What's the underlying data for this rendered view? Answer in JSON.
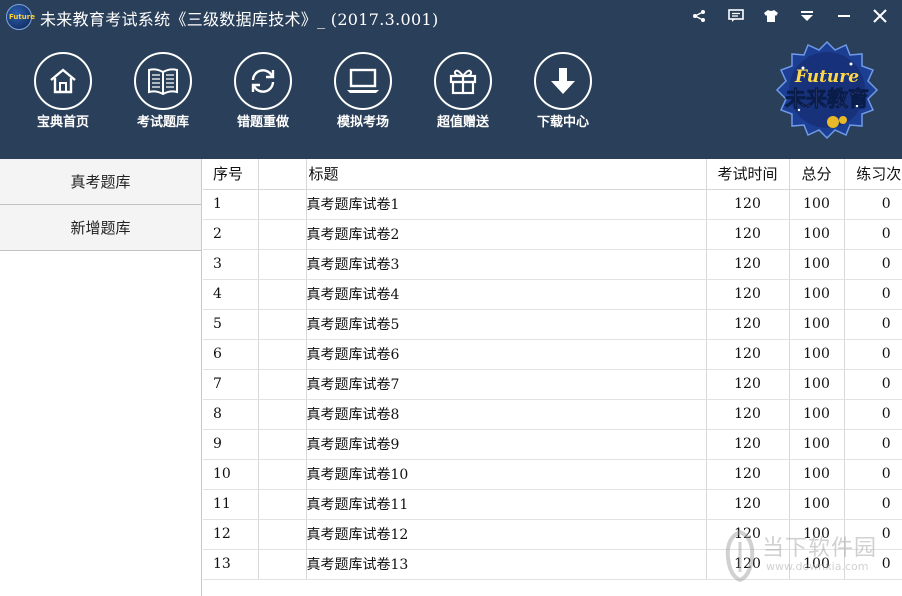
{
  "app": {
    "title": "未来教育考试系统《三级数据库技术》_ (2017.3.001)",
    "logo_text": "Future",
    "brand_text_en": "Future",
    "brand_text_cn": "未来教育"
  },
  "window_controls": [
    "share-icon",
    "message-icon",
    "skin-icon",
    "menu-icon",
    "minimize-icon",
    "close-icon"
  ],
  "toolbar": [
    {
      "label": "宝典首页",
      "icon": "home-icon"
    },
    {
      "label": "考试题库",
      "icon": "book-icon"
    },
    {
      "label": "错题重做",
      "icon": "refresh-icon"
    },
    {
      "label": "模拟考场",
      "icon": "laptop-icon"
    },
    {
      "label": "超值赠送",
      "icon": "gift-icon"
    },
    {
      "label": "下载中心",
      "icon": "download-icon"
    }
  ],
  "sidebar": {
    "items": [
      {
        "label": "真考题库"
      },
      {
        "label": "新增题库"
      }
    ]
  },
  "table": {
    "headers": {
      "no": "序号",
      "title": "标题",
      "time": "考试时间",
      "score": "总分",
      "count": "练习次数"
    },
    "rows": [
      {
        "no": "1",
        "title": "真考题库试卷1",
        "time": "120",
        "score": "100",
        "count": "0"
      },
      {
        "no": "2",
        "title": "真考题库试卷2",
        "time": "120",
        "score": "100",
        "count": "0"
      },
      {
        "no": "3",
        "title": "真考题库试卷3",
        "time": "120",
        "score": "100",
        "count": "0"
      },
      {
        "no": "4",
        "title": "真考题库试卷4",
        "time": "120",
        "score": "100",
        "count": "0"
      },
      {
        "no": "5",
        "title": "真考题库试卷5",
        "time": "120",
        "score": "100",
        "count": "0"
      },
      {
        "no": "6",
        "title": "真考题库试卷6",
        "time": "120",
        "score": "100",
        "count": "0"
      },
      {
        "no": "7",
        "title": "真考题库试卷7",
        "time": "120",
        "score": "100",
        "count": "0"
      },
      {
        "no": "8",
        "title": "真考题库试卷8",
        "time": "120",
        "score": "100",
        "count": "0"
      },
      {
        "no": "9",
        "title": "真考题库试卷9",
        "time": "120",
        "score": "100",
        "count": "0"
      },
      {
        "no": "10",
        "title": "真考题库试卷10",
        "time": "120",
        "score": "100",
        "count": "0"
      },
      {
        "no": "11",
        "title": "真考题库试卷11",
        "time": "120",
        "score": "100",
        "count": "0"
      },
      {
        "no": "12",
        "title": "真考题库试卷12",
        "time": "120",
        "score": "100",
        "count": "0"
      },
      {
        "no": "13",
        "title": "真考题库试卷13",
        "time": "120",
        "score": "100",
        "count": "0"
      }
    ]
  },
  "watermark": {
    "line1": "当下软件园",
    "line2": "www.downxia.com"
  },
  "colors": {
    "header_bg": "#2a3f59",
    "header_text": "#ffffff",
    "sidebar_bg": "#f4f4f4",
    "table_border": "#d8d8d8"
  }
}
